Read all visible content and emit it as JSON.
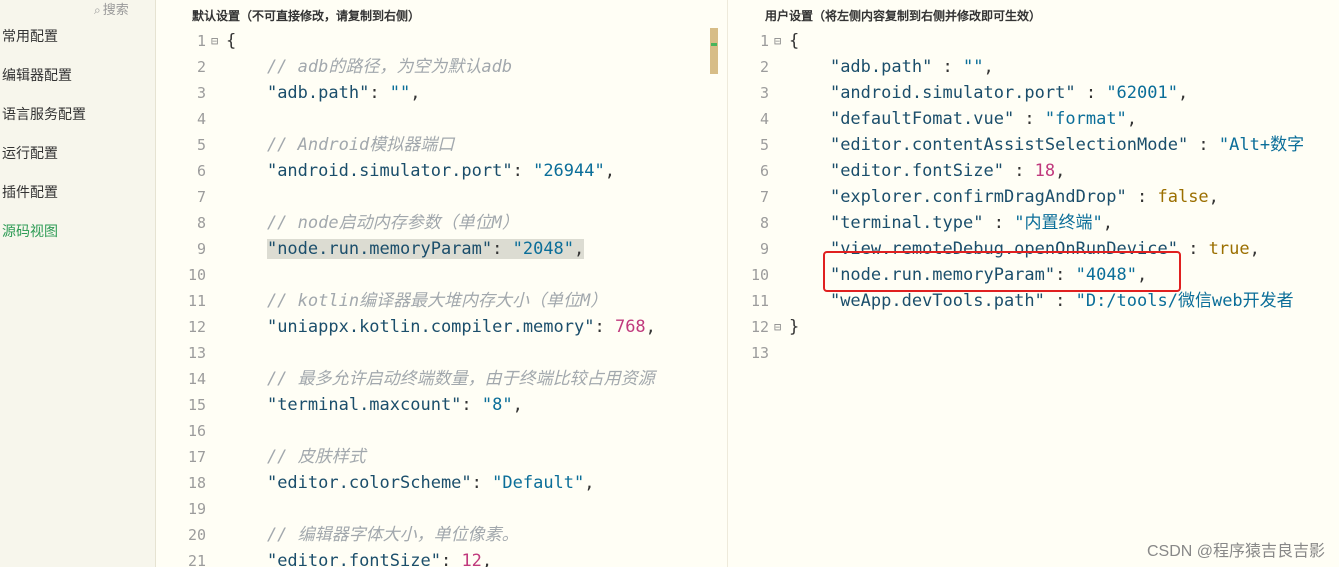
{
  "sidebar": {
    "search_label": "搜索",
    "search_icon": "search-icon",
    "items": [
      {
        "label": "常用配置",
        "active": false
      },
      {
        "label": "编辑器配置",
        "active": false
      },
      {
        "label": "语言服务配置",
        "active": false
      },
      {
        "label": "运行配置",
        "active": false
      },
      {
        "label": "插件配置",
        "active": false
      },
      {
        "label": "源码视图",
        "active": true
      }
    ],
    "active_color": "#2d9b55"
  },
  "left_panel": {
    "header": "默认设置（不可直接修改，请复制到右侧）",
    "lines": [
      {
        "n": "1",
        "fold": "⊟",
        "tokens": [
          {
            "t": "{",
            "c": "p"
          }
        ]
      },
      {
        "n": "2",
        "tokens": [
          {
            "t": "    // adb的路径，为空为默认adb",
            "c": "c"
          }
        ]
      },
      {
        "n": "3",
        "tokens": [
          {
            "t": "    ",
            "c": "p"
          },
          {
            "t": "\"adb.path\"",
            "c": "k"
          },
          {
            "t": ": ",
            "c": "p"
          },
          {
            "t": "\"\"",
            "c": "s"
          },
          {
            "t": ",",
            "c": "p"
          }
        ]
      },
      {
        "n": "4",
        "tokens": []
      },
      {
        "n": "5",
        "tokens": [
          {
            "t": "    // Android模拟器端口",
            "c": "c"
          }
        ]
      },
      {
        "n": "6",
        "tokens": [
          {
            "t": "    ",
            "c": "p"
          },
          {
            "t": "\"android.simulator.port\"",
            "c": "k"
          },
          {
            "t": ": ",
            "c": "p"
          },
          {
            "t": "\"26944\"",
            "c": "s"
          },
          {
            "t": ",",
            "c": "p"
          }
        ]
      },
      {
        "n": "7",
        "tokens": []
      },
      {
        "n": "8",
        "tokens": [
          {
            "t": "    // node启动内存参数（单位M）",
            "c": "c"
          }
        ]
      },
      {
        "n": "9",
        "tokens": [
          {
            "t": "    ",
            "c": "p"
          },
          {
            "t": "\"node.run.memoryParam\"",
            "c": "k hl"
          },
          {
            "t": ": ",
            "c": "p hl"
          },
          {
            "t": "\"2048\"",
            "c": "s hl"
          },
          {
            "t": ",",
            "c": "p hl"
          }
        ]
      },
      {
        "n": "10",
        "tokens": []
      },
      {
        "n": "11",
        "tokens": [
          {
            "t": "    // kotlin编译器最大堆内存大小（单位M）",
            "c": "c"
          }
        ]
      },
      {
        "n": "12",
        "tokens": [
          {
            "t": "    ",
            "c": "p"
          },
          {
            "t": "\"uniappx.kotlin.compiler.memory\"",
            "c": "k"
          },
          {
            "t": ": ",
            "c": "p"
          },
          {
            "t": "768",
            "c": "n"
          },
          {
            "t": ",",
            "c": "p"
          }
        ]
      },
      {
        "n": "13",
        "tokens": []
      },
      {
        "n": "14",
        "tokens": [
          {
            "t": "    // 最多允许启动终端数量，由于终端比较占用资源",
            "c": "c"
          }
        ]
      },
      {
        "n": "15",
        "tokens": [
          {
            "t": "    ",
            "c": "p"
          },
          {
            "t": "\"terminal.maxcount\"",
            "c": "k"
          },
          {
            "t": ": ",
            "c": "p"
          },
          {
            "t": "\"8\"",
            "c": "s"
          },
          {
            "t": ",",
            "c": "p"
          }
        ]
      },
      {
        "n": "16",
        "tokens": []
      },
      {
        "n": "17",
        "tokens": [
          {
            "t": "    // 皮肤样式",
            "c": "c"
          }
        ]
      },
      {
        "n": "18",
        "tokens": [
          {
            "t": "    ",
            "c": "p"
          },
          {
            "t": "\"editor.colorScheme\"",
            "c": "k"
          },
          {
            "t": ": ",
            "c": "p"
          },
          {
            "t": "\"Default\"",
            "c": "s"
          },
          {
            "t": ",",
            "c": "p"
          }
        ]
      },
      {
        "n": "19",
        "tokens": []
      },
      {
        "n": "20",
        "tokens": [
          {
            "t": "    // 编辑器字体大小，单位像素。",
            "c": "c"
          }
        ]
      },
      {
        "n": "21",
        "tokens": [
          {
            "t": "    ",
            "c": "p"
          },
          {
            "t": "\"editor.fontSize\"",
            "c": "k"
          },
          {
            "t": ": ",
            "c": "p"
          },
          {
            "t": "12",
            "c": "n"
          },
          {
            "t": ",",
            "c": "p"
          }
        ]
      }
    ]
  },
  "right_panel": {
    "header": "用户设置（将左侧内容复制到右侧并修改即可生效）",
    "lines": [
      {
        "n": "1",
        "fold": "⊟",
        "tokens": [
          {
            "t": "{",
            "c": "p"
          }
        ]
      },
      {
        "n": "2",
        "tokens": [
          {
            "t": "    ",
            "c": "p"
          },
          {
            "t": "\"adb.path\"",
            "c": "k"
          },
          {
            "t": " : ",
            "c": "p"
          },
          {
            "t": "\"\"",
            "c": "s"
          },
          {
            "t": ",",
            "c": "p"
          }
        ]
      },
      {
        "n": "3",
        "tokens": [
          {
            "t": "    ",
            "c": "p"
          },
          {
            "t": "\"android.simulator.port\"",
            "c": "k"
          },
          {
            "t": " : ",
            "c": "p"
          },
          {
            "t": "\"62001\"",
            "c": "s"
          },
          {
            "t": ",",
            "c": "p"
          }
        ]
      },
      {
        "n": "4",
        "tokens": [
          {
            "t": "    ",
            "c": "p"
          },
          {
            "t": "\"defaultFomat.vue\"",
            "c": "k"
          },
          {
            "t": " : ",
            "c": "p"
          },
          {
            "t": "\"format\"",
            "c": "s"
          },
          {
            "t": ",",
            "c": "p"
          }
        ]
      },
      {
        "n": "5",
        "tokens": [
          {
            "t": "    ",
            "c": "p"
          },
          {
            "t": "\"editor.contentAssistSelectionMode\"",
            "c": "k"
          },
          {
            "t": " : ",
            "c": "p"
          },
          {
            "t": "\"Alt+数字",
            "c": "s"
          }
        ]
      },
      {
        "n": "6",
        "tokens": [
          {
            "t": "    ",
            "c": "p"
          },
          {
            "t": "\"editor.fontSize\"",
            "c": "k"
          },
          {
            "t": " : ",
            "c": "p"
          },
          {
            "t": "18",
            "c": "n"
          },
          {
            "t": ",",
            "c": "p"
          }
        ]
      },
      {
        "n": "7",
        "tokens": [
          {
            "t": "    ",
            "c": "p"
          },
          {
            "t": "\"explorer.confirmDragAndDrop\"",
            "c": "k"
          },
          {
            "t": " : ",
            "c": "p"
          },
          {
            "t": "false",
            "c": "b"
          },
          {
            "t": ",",
            "c": "p"
          }
        ]
      },
      {
        "n": "8",
        "tokens": [
          {
            "t": "    ",
            "c": "p"
          },
          {
            "t": "\"terminal.type\"",
            "c": "k"
          },
          {
            "t": " : ",
            "c": "p"
          },
          {
            "t": "\"内置终端\"",
            "c": "s"
          },
          {
            "t": ",",
            "c": "p"
          }
        ]
      },
      {
        "n": "9",
        "tokens": [
          {
            "t": "    ",
            "c": "p"
          },
          {
            "t": "\"view.remoteDebug.openOnRunDevice\"",
            "c": "k"
          },
          {
            "t": " : ",
            "c": "p"
          },
          {
            "t": "true",
            "c": "b"
          },
          {
            "t": ",",
            "c": "p"
          }
        ]
      },
      {
        "n": "10",
        "tokens": [
          {
            "t": "    ",
            "c": "p"
          },
          {
            "t": "\"node.run.memoryParam\"",
            "c": "k"
          },
          {
            "t": ": ",
            "c": "p"
          },
          {
            "t": "\"4048\"",
            "c": "s"
          },
          {
            "t": ",",
            "c": "p"
          }
        ]
      },
      {
        "n": "11",
        "tokens": [
          {
            "t": "    ",
            "c": "p"
          },
          {
            "t": "\"weApp.devTools.path\"",
            "c": "k"
          },
          {
            "t": " : ",
            "c": "p"
          },
          {
            "t": "\"D:/tools/微信web开发者",
            "c": "s"
          }
        ]
      },
      {
        "n": "12",
        "fold": "⊟",
        "tokens": [
          {
            "t": "}",
            "c": "p"
          }
        ]
      },
      {
        "n": "13",
        "tokens": []
      }
    ]
  },
  "highlight_box_color": "#e02020",
  "watermark": "CSDN @程序猿吉良吉影"
}
